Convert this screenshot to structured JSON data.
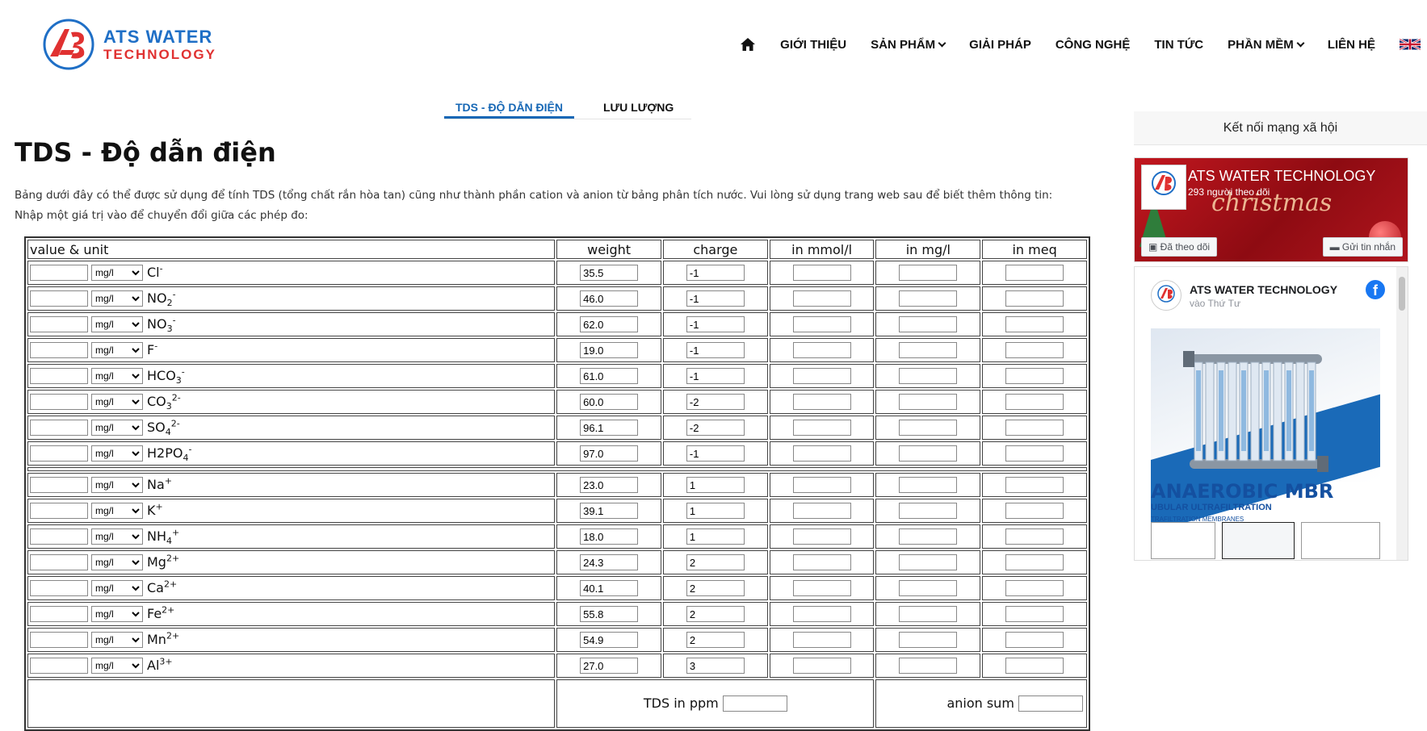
{
  "brand": {
    "line1": "ATS WATER",
    "line2": "TECHNOLOGY",
    "colors": {
      "blue": "#1f6fc6",
      "red": "#e03131"
    }
  },
  "nav": {
    "home_icon": "home-icon",
    "items": [
      {
        "label": "GIỚI THIỆU",
        "dropdown": false
      },
      {
        "label": "SẢN PHẨM",
        "dropdown": true
      },
      {
        "label": "GIẢI PHÁP",
        "dropdown": false
      },
      {
        "label": "CÔNG NGHỆ",
        "dropdown": false
      },
      {
        "label": "TIN TỨC",
        "dropdown": false
      },
      {
        "label": "PHẦN MỀM",
        "dropdown": true
      },
      {
        "label": "LIÊN HỆ",
        "dropdown": false
      }
    ],
    "language_icon": "uk-flag-icon"
  },
  "tabs": [
    {
      "label": "TDS - ĐỘ DẪN ĐIỆN",
      "active": true
    },
    {
      "label": "LƯU LƯỢNG",
      "active": false
    }
  ],
  "page": {
    "title": "TDS - Độ dẫn điện",
    "description1": "Bảng dưới đây có thể được sử dụng để tính TDS (tổng chất rắn hòa tan) cũng như thành phần cation và anion từ bảng phân tích nước. Vui lòng sử dụng trang web sau để biết thêm thông tin:",
    "description2": "Nhập một giá trị vào để chuyển đổi giữa các phép đo:"
  },
  "calculator": {
    "headers": {
      "value_unit": "value & unit",
      "weight": "weight",
      "charge": "charge",
      "mmol": "in mmol/l",
      "mgl": "in mg/l",
      "meq": "in meq"
    },
    "unit_selected": "mg/l",
    "anions": [
      {
        "base": "Cl",
        "sub": "",
        "sup": "-",
        "weight": "35.5",
        "charge": "-1"
      },
      {
        "base": "NO",
        "sub": "2",
        "sup": "-",
        "weight": "46.0",
        "charge": "-1"
      },
      {
        "base": "NO",
        "sub": "3",
        "sup": "-",
        "weight": "62.0",
        "charge": "-1"
      },
      {
        "base": "F",
        "sub": "",
        "sup": "-",
        "weight": "19.0",
        "charge": "-1"
      },
      {
        "base": "HCO",
        "sub": "3",
        "sup": "-",
        "weight": "61.0",
        "charge": "-1"
      },
      {
        "base": "CO",
        "sub": "3",
        "sup": "2-",
        "weight": "60.0",
        "charge": "-2"
      },
      {
        "base": "SO",
        "sub": "4",
        "sup": "2-",
        "weight": "96.1",
        "charge": "-2"
      },
      {
        "base": "H2PO",
        "sub": "4",
        "sup": "-",
        "weight": "97.0",
        "charge": "-1"
      }
    ],
    "cations": [
      {
        "base": "Na",
        "sub": "",
        "sup": "+",
        "weight": "23.0",
        "charge": "1"
      },
      {
        "base": "K",
        "sub": "",
        "sup": "+",
        "weight": "39.1",
        "charge": "1"
      },
      {
        "base": "NH",
        "sub": "4",
        "sup": "+",
        "weight": "18.0",
        "charge": "1"
      },
      {
        "base": "Mg",
        "sub": "",
        "sup": "2+",
        "weight": "24.3",
        "charge": "2"
      },
      {
        "base": "Ca",
        "sub": "",
        "sup": "2+",
        "weight": "40.1",
        "charge": "2"
      },
      {
        "base": "Fe",
        "sub": "",
        "sup": "2+",
        "weight": "55.8",
        "charge": "2"
      },
      {
        "base": "Mn",
        "sub": "",
        "sup": "2+",
        "weight": "54.9",
        "charge": "2"
      },
      {
        "base": "Al",
        "sub": "",
        "sup": "3+",
        "weight": "27.0",
        "charge": "3"
      }
    ],
    "tds_label": "TDS in ppm",
    "anion_sum_label": "anion sum"
  },
  "sidebar": {
    "heading": "Kết nối mạng xã hội",
    "fb_page_name": "ATS WATER TECHNOLOGY",
    "fb_followers": "293 người theo dõi",
    "fb_followed_btn": "Đã theo dõi",
    "fb_message_btn": "Gửi tin nhắn",
    "banner_text": "christmas",
    "post_author": "ATS WATER TECHNOLOGY",
    "post_time": "vào Thứ Tư",
    "post_title": "ANAEROBIC MBR",
    "post_subtitle": "UBULAR ULTRAFILTRATION",
    "post_subtitle2": "TRAFILTRATION MEMBRANES"
  }
}
